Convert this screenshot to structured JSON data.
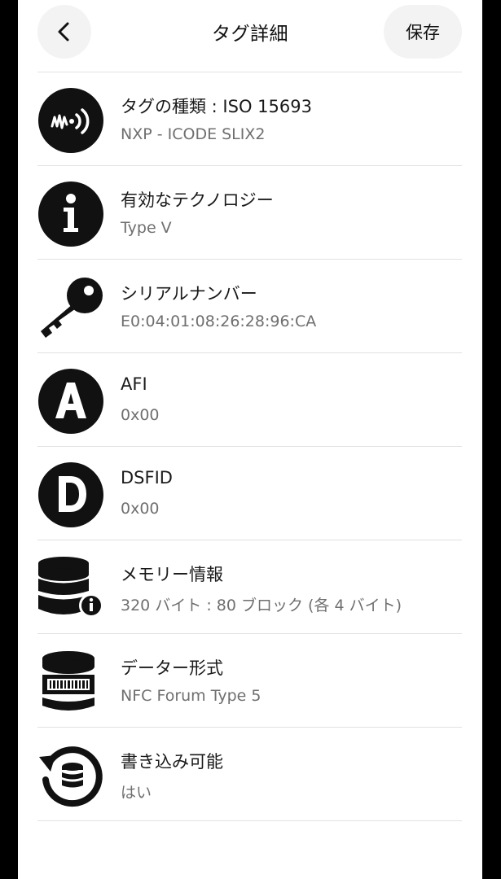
{
  "header": {
    "back_icon": "chevron-left-icon",
    "title": "タグ詳細",
    "save_label": "保存"
  },
  "rows": [
    {
      "icon": "nfc-tag-icon",
      "label": "タグの種類 : ISO 15693",
      "value": "NXP - ICODE SLIX2"
    },
    {
      "icon": "info-icon",
      "label": "有効なテクノロジー",
      "value": "Type V"
    },
    {
      "icon": "key-icon",
      "label": "シリアルナンバー",
      "value": "E0:04:01:08:26:28:96:CA"
    },
    {
      "icon": "letter-a-icon",
      "label": "AFI",
      "value": "0x00"
    },
    {
      "icon": "letter-d-icon",
      "label": "DSFID",
      "value": "0x00"
    },
    {
      "icon": "database-info-icon",
      "label": "メモリー情報",
      "value": "320 バイト : 80 ブロック (各 4 バイト)"
    },
    {
      "icon": "database-barcode-icon",
      "label": "データー形式",
      "value": "NFC Forum Type 5"
    },
    {
      "icon": "writable-refresh-icon",
      "label": "書き込み可能",
      "value": "はい"
    }
  ],
  "colors": {
    "background": "#ffffff",
    "icon": "#111111",
    "label": "#1a1a1a",
    "value": "#6f6f6f",
    "divider": "#e2e2e2"
  }
}
